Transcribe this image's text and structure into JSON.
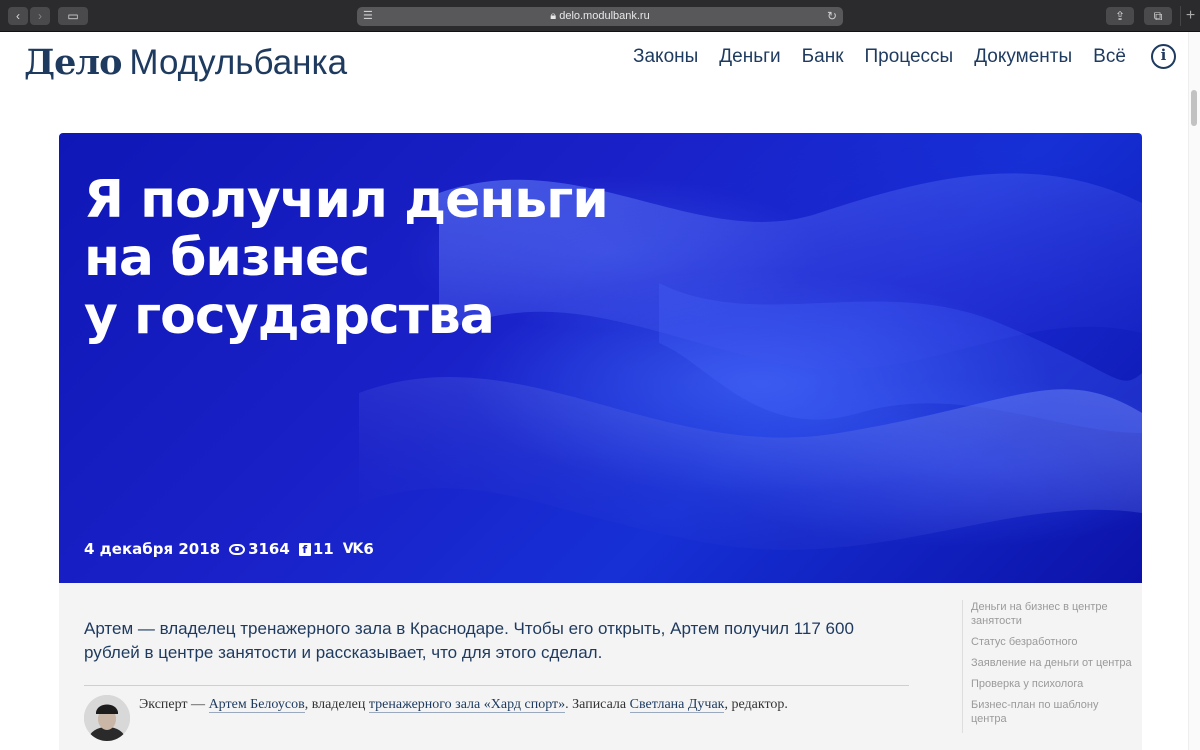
{
  "browser": {
    "url": "delo.modulbank.ru",
    "lock_icon": "lock-icon",
    "colors": {
      "toolbar": "#2b2b2d",
      "url_bar": "#58585b"
    }
  },
  "header": {
    "logo_bold": "Дело",
    "logo_light": "Модульбанка",
    "nav": [
      "Законы",
      "Деньги",
      "Банк",
      "Процессы",
      "Документы",
      "Всё"
    ],
    "info_glyph": "i",
    "brand_color": "#1e3a5f"
  },
  "hero": {
    "title_lines": [
      "Я получил деньги",
      "на бизнес",
      "у государства"
    ],
    "date": "4 декабря 2018",
    "views": "3164",
    "facebook_count": "11",
    "vk_count": "6",
    "vk_glyph": "VK",
    "fb_glyph": "f",
    "background_color": "#1a21c8"
  },
  "article": {
    "lead": "Артем — владелец тренажерного зала в Краснодаре. Чтобы его открыть, Артем получил 117 600 рублей в центре занятости и рассказывает, что для этого сделал.",
    "expert_prefix": "Эксперт — ",
    "expert_name": "Артем Белоусов",
    "expert_mid": ", владелец ",
    "expert_role": "тренажерного зала «Хард спорт»",
    "expert_sep": ". Записала ",
    "writer_name": "Светлана Дучак",
    "writer_role": ", редактор."
  },
  "toc": [
    "Деньги на бизнес в центре занятости",
    "Статус безработного",
    "Заявление на деньги от центра",
    "Проверка у психолога",
    "Бизнес-план по шаблону центра"
  ]
}
